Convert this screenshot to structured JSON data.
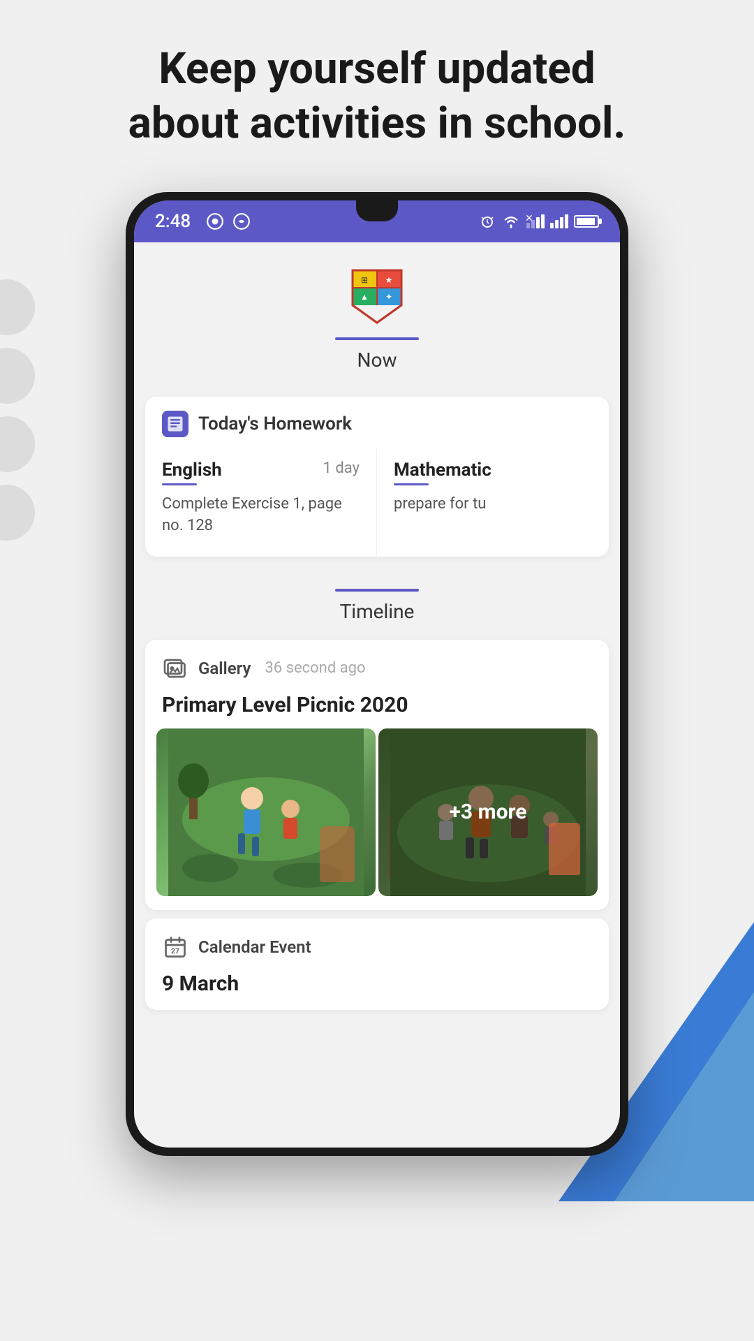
{
  "header": {
    "title_line1": "Keep yourself updated",
    "title_line2": "about activities in school."
  },
  "status_bar": {
    "time": "2:48",
    "left_icons": [
      "music-icon",
      "whatsapp-icon"
    ],
    "right_icons": [
      "alarm-icon",
      "wifi-icon",
      "signal-icon",
      "battery-icon"
    ]
  },
  "school": {
    "tab_label": "Now"
  },
  "homework": {
    "section_title": "Today's Homework",
    "items": [
      {
        "subject": "English",
        "due": "1 day",
        "description": "Complete Exercise 1, page no. 128"
      },
      {
        "subject": "Mathematic",
        "due": "",
        "description": "prepare for tu"
      }
    ]
  },
  "timeline": {
    "tab_label": "Timeline",
    "posts": [
      {
        "type": "Gallery",
        "time_ago": "36 second ago",
        "title": "Primary Level Picnic 2020",
        "more_count": "+3 more"
      },
      {
        "type": "Calendar Event",
        "time_ago": "",
        "title": "9 March"
      }
    ]
  }
}
